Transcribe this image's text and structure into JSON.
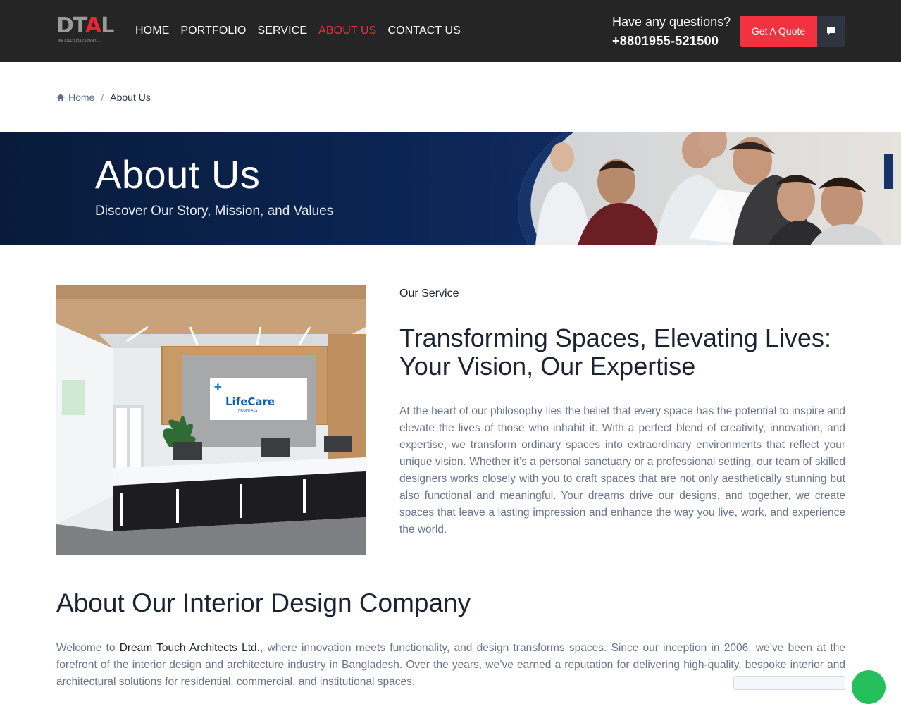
{
  "header": {
    "logo_text_left": "DT",
    "logo_text_mid": "A",
    "logo_text_right": "L",
    "logo_tagline": "we touch your dream....",
    "nav": [
      {
        "label": "HOME",
        "active": false
      },
      {
        "label": "PORTFOLIO",
        "active": false
      },
      {
        "label": "SERVICE",
        "active": false
      },
      {
        "label": "ABOUT US",
        "active": true
      },
      {
        "label": "CONTACT US",
        "active": false
      }
    ],
    "questions_label": "Have any questions?",
    "phone": "+8801955-521500",
    "quote_button": "Get A Quote",
    "chat_icon": "chat-bubble-icon",
    "accent_color": "#f2323f"
  },
  "breadcrumb": {
    "home": "Home",
    "separator": "/",
    "current": "About Us"
  },
  "banner": {
    "title": "About Us",
    "subtitle": "Discover Our Story, Mission, and Values"
  },
  "service": {
    "eyebrow": "Our Service",
    "headline": "Transforming Spaces, Elevating Lives: Your Vision, Our Expertise",
    "image_sign": "LifeCare",
    "image_sign_sub": "HOSPITALS",
    "paragraph": "At the heart of our philosophy lies the belief that every space has the potential to inspire and elevate the lives of those who inhabit it. With a perfect blend of creativity, innovation, and expertise, we transform ordinary spaces into extraordinary environments that reflect your unique vision. Whether it’s a personal sanctuary or a professional setting, our team of skilled designers works closely with you to craft spaces that are not only aesthetically stunning but also functional and meaningful. Your dreams drive our designs, and together, we create spaces that leave a lasting impression and enhance the way you live, work, and experience the world."
  },
  "about": {
    "title": "About Our Interior Design Company",
    "welcome_prefix": "Welcome to ",
    "company_name": "Dream Touch Architects Ltd.",
    "welcome_rest": ", where innovation meets functionality, and design transforms spaces. Since our inception in 2006, we’ve been at the forefront of the interior design and architecture industry in Bangladesh. Over the years, we’ve earned a reputation for delivering high-quality, bespoke interior and architectural solutions for residential, commercial, and institutional spaces."
  }
}
